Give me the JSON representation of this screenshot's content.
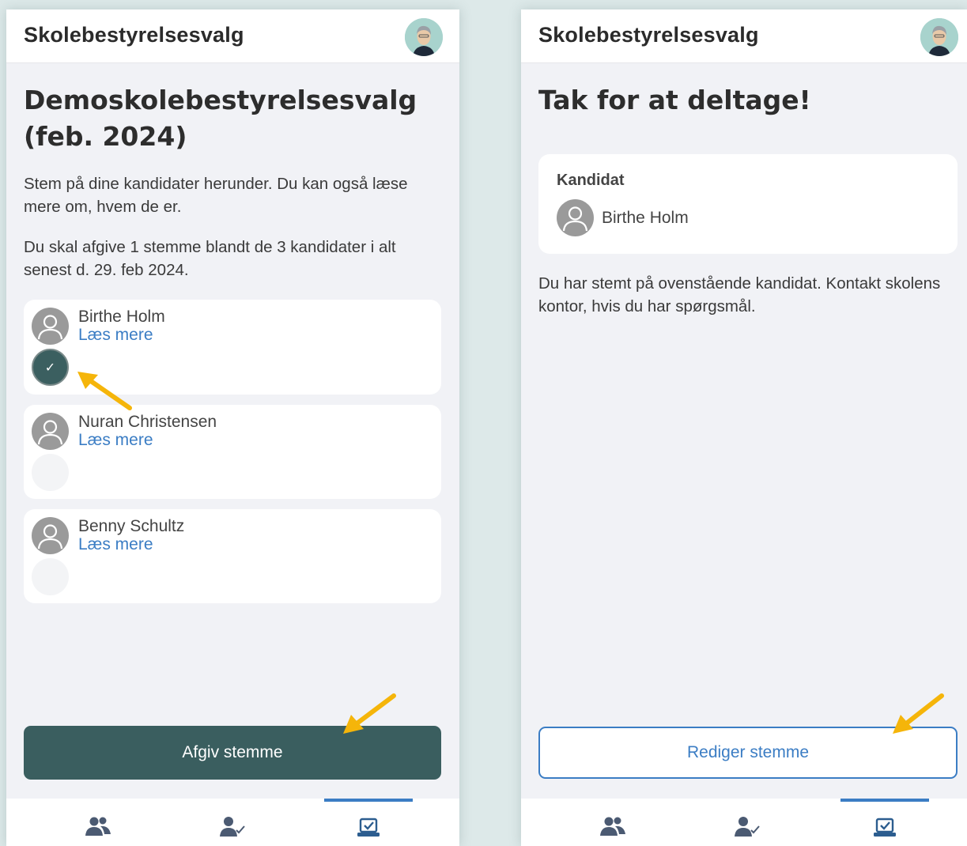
{
  "app_title": "Skolebestyrelsesvalg",
  "vote_screen": {
    "heading": "Demoskolebestyrelsesvalg (feb. 2024)",
    "intro": "Stem på dine kandidater herunder. Du kan også læse mere om, hvem de er.",
    "instructions": "Du skal afgive 1 stemme blandt de 3 kandidater i alt senest d. 29. feb 2024.",
    "candidates": [
      {
        "name": "Birthe Holm",
        "link": "Læs mere",
        "selected": true
      },
      {
        "name": "Nuran Christensen",
        "link": "Læs mere",
        "selected": false
      },
      {
        "name": "Benny Schultz",
        "link": "Læs mere",
        "selected": false
      }
    ],
    "submit_label": "Afgiv stemme"
  },
  "confirm_screen": {
    "heading": "Tak for at deltage!",
    "card_label": "Kandidat",
    "voted_candidate": "Birthe Holm",
    "message": "Du har stemt på ovenstående kandidat. Kontakt skolens kontor, hvis du har spørgsmål.",
    "edit_label": "Rediger stemme"
  },
  "bottom_nav": [
    {
      "icon": "people-icon",
      "active": false
    },
    {
      "icon": "person-check-icon",
      "active": false
    },
    {
      "icon": "ballot-box-icon",
      "active": true
    }
  ],
  "colors": {
    "primary": "#3a5e5f",
    "link": "#3b7dc4",
    "annotation_arrow": "#f5b50a",
    "background": "#f1f2f6"
  }
}
